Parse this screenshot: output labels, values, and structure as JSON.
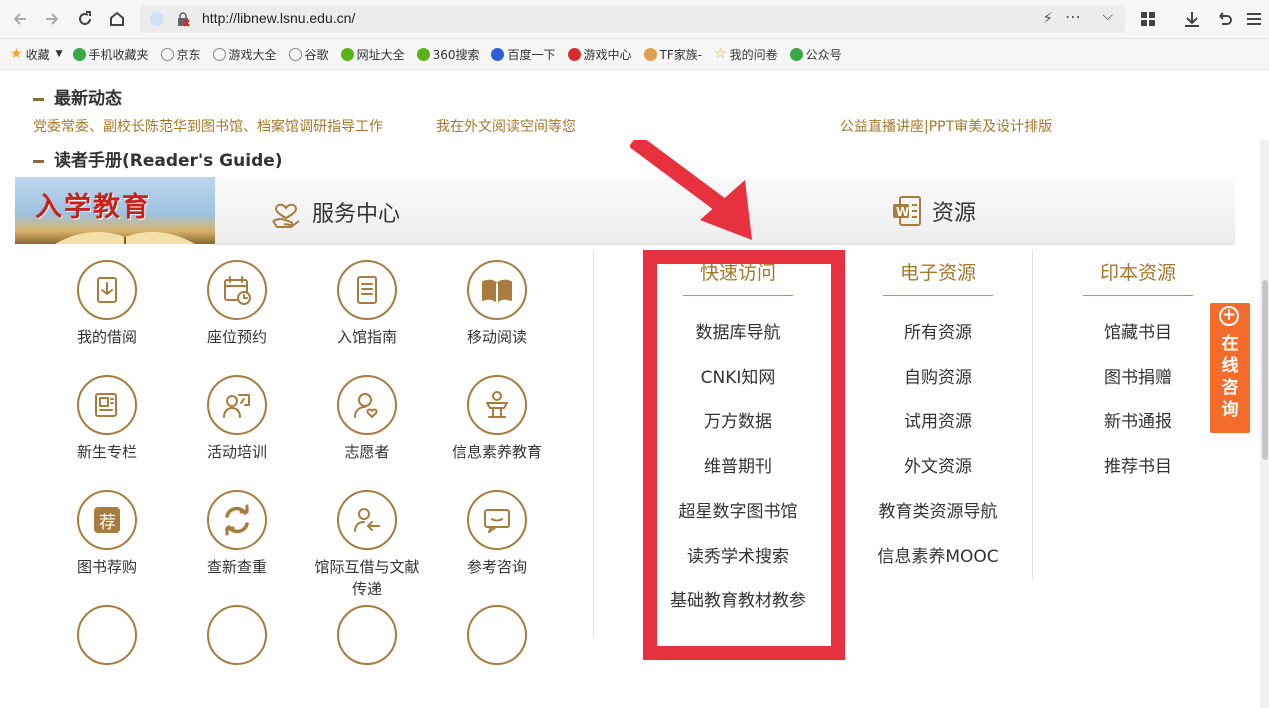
{
  "browser": {
    "url": "http://libnew.lsnu.edu.cn/",
    "bookmarks": [
      {
        "label": "收藏",
        "icon": "star-icon",
        "color": "#f5a623"
      },
      {
        "label": "手机收藏夹",
        "icon": "phone-icon",
        "color": "#3aa845"
      },
      {
        "label": "京东",
        "icon": "globe-icon",
        "color": "#888888"
      },
      {
        "label": "游戏大全",
        "icon": "globe-icon",
        "color": "#888888"
      },
      {
        "label": "谷歌",
        "icon": "globe-icon",
        "color": "#888888"
      },
      {
        "label": "网址大全",
        "icon": "site-icon",
        "color": "#5bb318"
      },
      {
        "label": "360搜索",
        "icon": "search-360-icon",
        "color": "#5bb318"
      },
      {
        "label": "百度一下",
        "icon": "paw-icon",
        "color": "#2e5fd6"
      },
      {
        "label": "游戏中心",
        "icon": "game-icon",
        "color": "#d52e2e"
      },
      {
        "label": "TF家族-",
        "icon": "tf-icon",
        "color": "#e0a050"
      },
      {
        "label": "我的问卷",
        "icon": "star-outline-icon",
        "color": "#f5a623"
      },
      {
        "label": "公众号",
        "icon": "wechat-icon",
        "color": "#3aa845"
      }
    ]
  },
  "page": {
    "latest_title": "最新动态",
    "news": [
      "党委常委、副校长陈范华到图书馆、档案馆调研指导工作",
      "我在外文阅读空间等您",
      "公益直播讲座|PPT审美及设计排版"
    ],
    "guide_title": "读者手册(Reader's Guide)",
    "banner_text": "入学教育",
    "tabs": [
      {
        "label": "服务中心",
        "icon": "heart-hand-icon"
      },
      {
        "label": "资源",
        "icon": "word-doc-icon"
      }
    ],
    "services": [
      {
        "label": "我的借阅",
        "icon": "borrow-icon"
      },
      {
        "label": "座位预约",
        "icon": "calendar-clock-icon"
      },
      {
        "label": "入馆指南",
        "icon": "guide-doc-icon"
      },
      {
        "label": "移动阅读",
        "icon": "open-book-icon"
      },
      {
        "label": "新生专栏",
        "icon": "newspaper-icon"
      },
      {
        "label": "活动培训",
        "icon": "trainer-icon"
      },
      {
        "label": "志愿者",
        "icon": "volunteer-icon"
      },
      {
        "label": "信息素养教育",
        "icon": "lectern-icon"
      },
      {
        "label": "图书荐购",
        "icon": "recommend-icon"
      },
      {
        "label": "查新查重",
        "icon": "refresh-icon"
      },
      {
        "label": "馆际互借与文献传递",
        "icon": "transfer-user-icon"
      },
      {
        "label": "参考咨询",
        "icon": "chat-icon"
      }
    ],
    "columns": [
      {
        "title": "快速访问",
        "items": [
          "数据库导航",
          "CNKI知网",
          "万方数据",
          "维普期刊",
          "超星数字图书馆",
          "读秀学术搜索",
          "基础教育教材教参"
        ]
      },
      {
        "title": "电子资源",
        "items": [
          "所有资源",
          "自购资源",
          "试用资源",
          "外文资源",
          "教育类资源导航",
          "信息素养MOOC"
        ]
      },
      {
        "title": "印本资源",
        "items": [
          "馆藏书目",
          "图书捐赠",
          "新书通报",
          "推荐书目"
        ]
      }
    ],
    "consult_widget": "在线咨询"
  },
  "colors": {
    "accent": "#a4782c",
    "annotation_red": "#e7313e",
    "widget_orange": "#f36c2b"
  }
}
